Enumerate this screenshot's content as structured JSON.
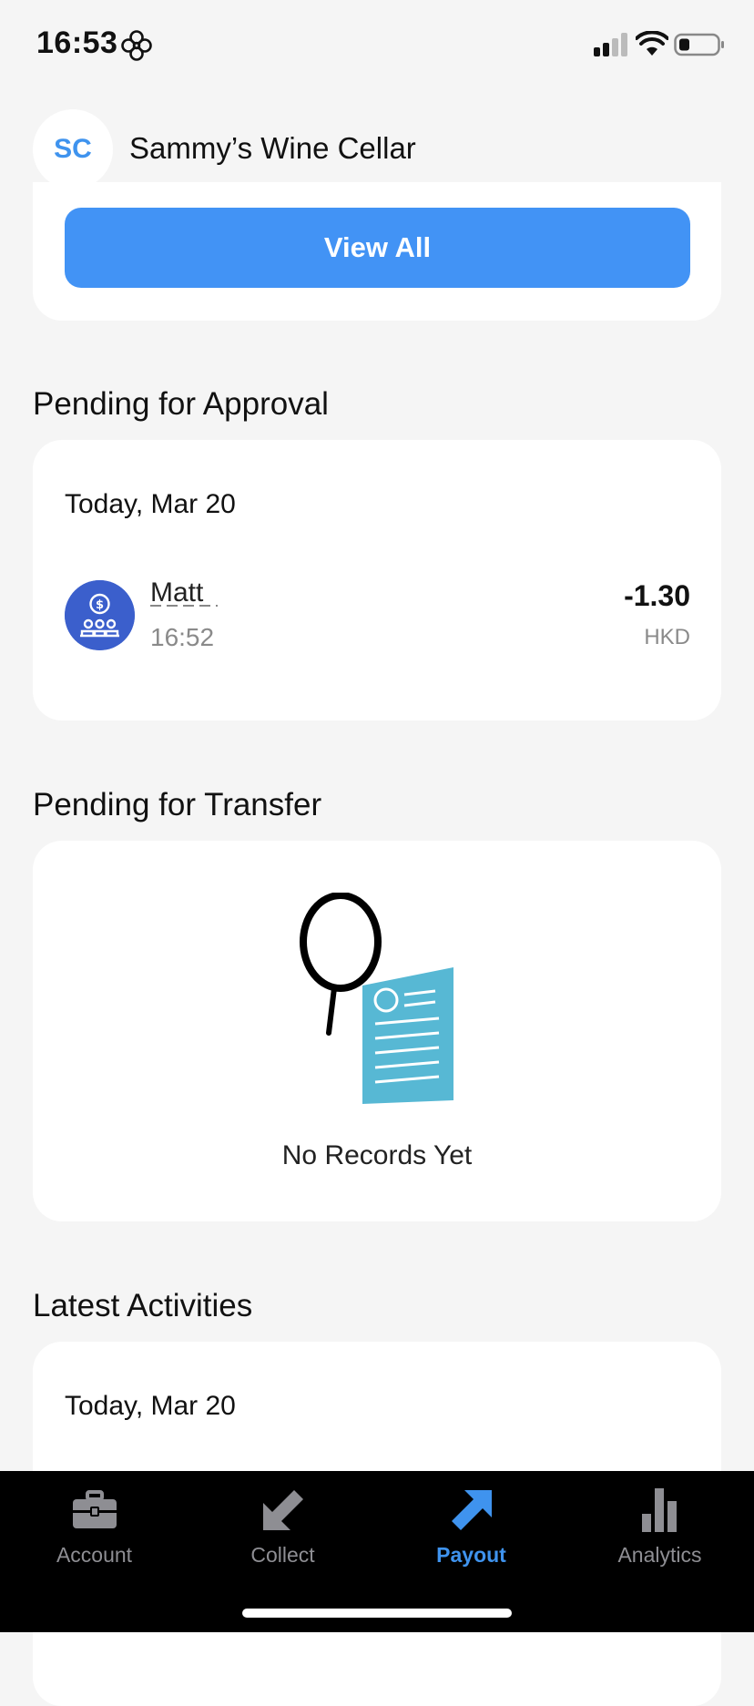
{
  "status_bar": {
    "time": "16:53"
  },
  "header": {
    "avatar_initials": "SC",
    "merchant_name": "Sammy’s Wine Cellar"
  },
  "top_card": {
    "view_all_label": "View All"
  },
  "pending_approval": {
    "title": "Pending for Approval",
    "date": "Today, Mar 20",
    "transactions": [
      {
        "name": "Matt",
        "time": "16:52",
        "amount": "-1.30",
        "currency": "HKD"
      }
    ]
  },
  "pending_transfer": {
    "title": "Pending for Transfer",
    "empty_text": "No Records Yet"
  },
  "latest_activities": {
    "title": "Latest Activities",
    "date": "Today, Mar 20"
  },
  "bottom_nav": {
    "items": [
      {
        "label": "Account",
        "icon": "briefcase-icon"
      },
      {
        "label": "Collect",
        "icon": "arrow-down-left-icon"
      },
      {
        "label": "Payout",
        "icon": "arrow-up-right-icon",
        "active": true
      },
      {
        "label": "Analytics",
        "icon": "bar-chart-icon"
      }
    ]
  },
  "colors": {
    "accent": "#4293f5",
    "transaction_icon_bg": "#3b5fcc",
    "background": "#f5f5f5",
    "nav_background": "#000000",
    "inactive_nav": "#8e8e93"
  }
}
